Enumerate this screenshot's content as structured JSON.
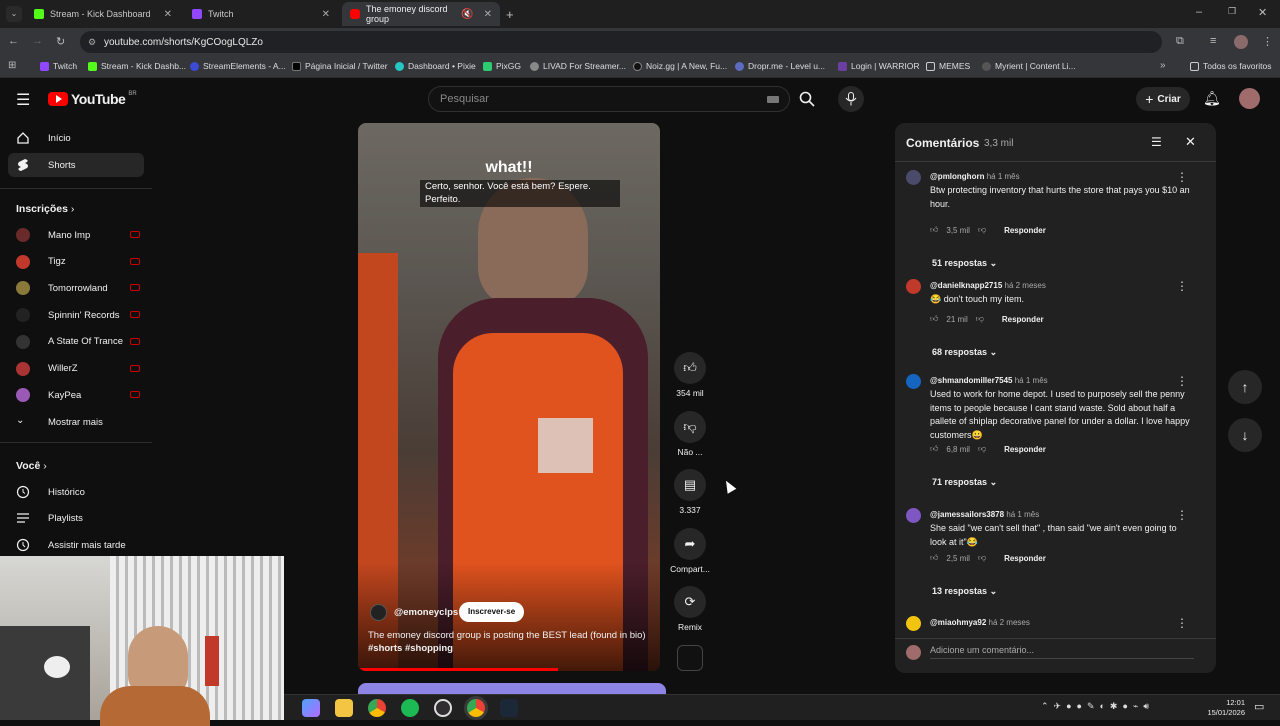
{
  "browser": {
    "tabs": [
      {
        "title": "Stream - Kick Dashboard",
        "color": "#53fc18"
      },
      {
        "title": "Twitch",
        "color": "#9146ff"
      },
      {
        "title": "The emoney discord group",
        "color": "#ff0000"
      }
    ],
    "url": "youtube.com/shorts/KgCOogLQLZo",
    "bookmarks": [
      "Twitch",
      "Stream - Kick Dashb...",
      "StreamElements - A...",
      "Página Inicial / Twitter",
      "Dashboard • Pixie",
      "PixGG",
      "LIVAD For Streamer...",
      "Noiz.gg | A New, Fu...",
      "Dropr.me - Level u...",
      "Login | WARRIOR",
      "MEMES",
      "Myrient | Content Li..."
    ],
    "all_bookmarks": "Todos os favoritos"
  },
  "youtube": {
    "logo": "YouTube",
    "region": "BR",
    "search_placeholder": "Pesquisar",
    "create_label": "Criar"
  },
  "sidebar": {
    "home": "Início",
    "shorts": "Shorts",
    "subs_header": "Inscrições",
    "channels": [
      {
        "name": "Mano Imp",
        "color": "#6a2a2a"
      },
      {
        "name": "Tigz",
        "color": "#c0392b"
      },
      {
        "name": "Tomorrowland",
        "color": "#8a7a3a"
      },
      {
        "name": "Spinnin' Records",
        "color": "#222"
      },
      {
        "name": "A State Of Trance",
        "color": "#333"
      },
      {
        "name": "WillerZ",
        "color": "#a33"
      },
      {
        "name": "KayPea",
        "color": "#9b59b6"
      }
    ],
    "show_more": "Mostrar mais",
    "you_header": "Você",
    "history": "Histórico",
    "playlists": "Playlists",
    "watch_later": "Assistir mais tarde"
  },
  "video": {
    "overlay_title": "what!!",
    "caption": "Certo, senhor.  Você está bem?  Espere. Perfeito.",
    "channel": "@emoneyclps",
    "subscribe": "Inscrever-se",
    "description": "The emoney discord group is posting the BEST lead (found in bio)",
    "tags": "#shorts #shopping"
  },
  "actions": {
    "likes": "354 mil",
    "dislike": "Não ...",
    "comments": "3.337",
    "share": "Compart...",
    "remix": "Remix"
  },
  "comments_panel": {
    "title": "Comentários",
    "count": "3,3 mil",
    "add_placeholder": "Adicione um comentário...",
    "reply_label": "Responder",
    "items": [
      {
        "user": "@pmlonghorn",
        "time": "há 1 mês",
        "text": "Btw protecting inventory that hurts the store that pays you $10 an hour.",
        "likes": "3,5 mil",
        "replies": "51 respostas",
        "avatar": "#4a4a6a"
      },
      {
        "user": "@danielknapp2715",
        "time": "há 2 meses",
        "text": "😂 don't touch my item.",
        "likes": "21 mil",
        "replies": "68 respostas",
        "avatar": "#c0392b"
      },
      {
        "user": "@shmandomiller7545",
        "time": "há 1 mês",
        "text": "Used to work for home depot. I used to purposely sell the penny items to people because I cant stand waste. Sold about half a pallete of shiplap decorative panel for under a dollar. I love happy customers😀",
        "likes": "6,8 mil",
        "replies": "71 respostas",
        "avatar": "#1565c0"
      },
      {
        "user": "@jamessailors3878",
        "time": "há 1 mês",
        "text": "She said \"we can't sell that\" , than said \"we ain't even going to look at it\"😂",
        "likes": "2,5 mil",
        "replies": "13 respostas",
        "avatar": "#7e57c2"
      },
      {
        "user": "@miaohmya92",
        "time": "há 2 meses",
        "text": "",
        "likes": "",
        "replies": "",
        "avatar": "#f1c40f"
      }
    ]
  },
  "taskbar": {
    "time": "12:01",
    "date": "15/01/2026"
  }
}
